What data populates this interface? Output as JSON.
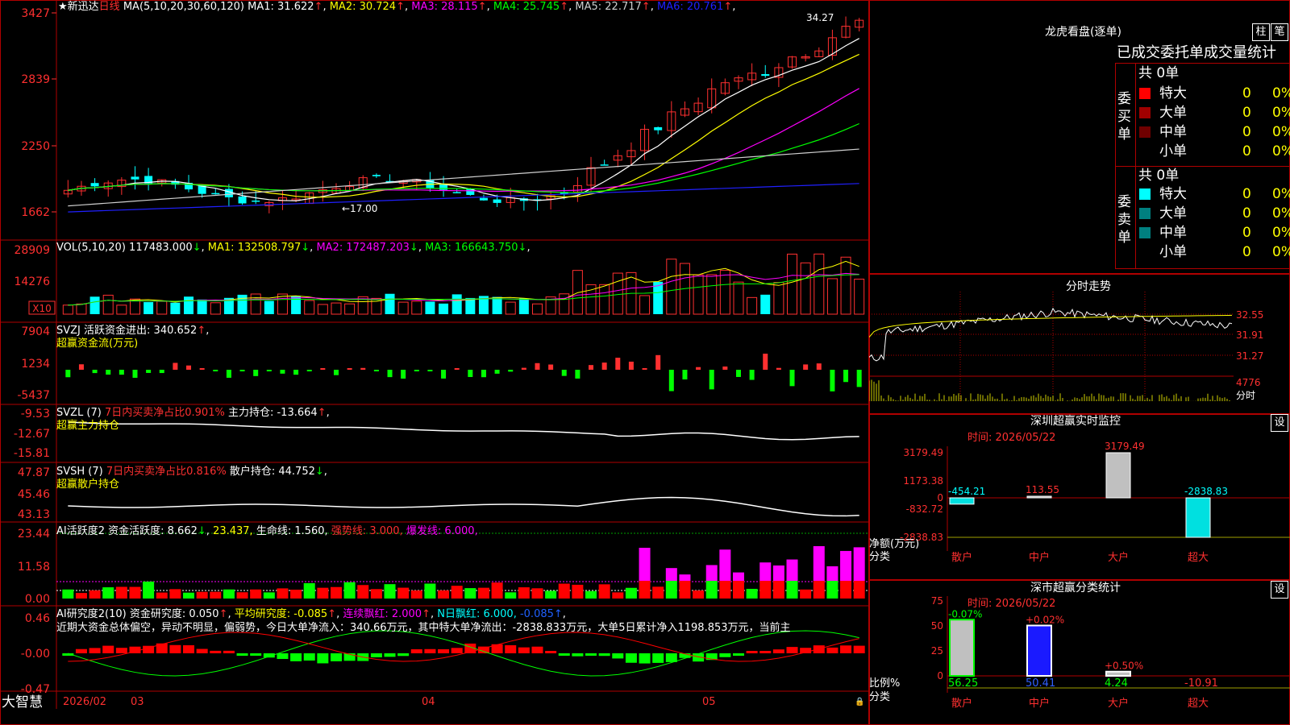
{
  "stock": {
    "star": "★",
    "name": "新迅达",
    "period": "日线"
  },
  "main": {
    "ma_label": "MA(5,10,20,30,60,120)",
    "ma": [
      {
        "name": "MA1",
        "value": "31.622",
        "color": "#ffffff"
      },
      {
        "name": "MA2",
        "value": "30.724",
        "color": "#ffff00"
      },
      {
        "name": "MA3",
        "value": "28.115",
        "color": "#ff00ff"
      },
      {
        "name": "MA4",
        "value": "25.745",
        "color": "#00ff00"
      },
      {
        "name": "MA5",
        "value": "22.717",
        "color": "#d0d0d0"
      },
      {
        "name": "MA6",
        "value": "20.761",
        "color": "#2020ff"
      }
    ],
    "y_ticks": [
      "3427",
      "2839",
      "2250",
      "1662"
    ],
    "high_label": "34.27",
    "low_label": "←17.00"
  },
  "vol": {
    "label": "VOL(5,10,20)",
    "value": "117483.000",
    "ma": [
      {
        "name": "MA1",
        "value": "132508.797",
        "color": "#ffff00"
      },
      {
        "name": "MA2",
        "value": "172487.203",
        "color": "#ff00ff"
      },
      {
        "name": "MA3",
        "value": "166643.750",
        "color": "#00ff00"
      }
    ],
    "y_ticks": [
      "28909",
      "14276"
    ],
    "unit": "X10"
  },
  "svzj": {
    "label": "SVZJ",
    "text": "活跃资金进出: 340.652",
    "sub": "超赢资金流(万元)",
    "y_ticks": [
      "7904",
      "1234",
      "-5437"
    ]
  },
  "svzl": {
    "label": "SVZL (7)",
    "text1": "7日内买卖净占比0.901%",
    "text2": "主力持仓: -13.664",
    "sub": "超赢主力持仓",
    "y_ticks": [
      "-9.53",
      "-12.67",
      "-15.81"
    ]
  },
  "svsh": {
    "label": "SVSH (7)",
    "text1": "7日内买卖净占比0.816%",
    "text2": "散户持仓: 44.752",
    "sub": "超赢散户持仓",
    "y_ticks": [
      "47.87",
      "45.46",
      "43.13"
    ]
  },
  "ai1": {
    "label": "AI活跃度2",
    "t1": "资金活跃度: 8.662",
    "t2": "23.437,",
    "t3": "生命线: 1.560,",
    "t4": "强势线: 3.000,",
    "t5": "爆发线: 6.000,",
    "y_ticks": [
      "23.44",
      "11.58",
      "0.00"
    ]
  },
  "ai2": {
    "label": "AI研究度2(10)",
    "t1": "资金研究度: 0.050",
    "t2": "平均研究度: -0.085",
    "t3": "连续飘红: 2.000",
    "t4": "N日飘红: 6.000,",
    "t5": "-0.085",
    "comment": "近期大资金总体偏空，异动不明显，偏弱势，今日大单净流入：340.66万元，其中特大单净流出：-2838.833万元，大单5日累计净入1198.853万元，当前主",
    "y_ticks": [
      "0.46",
      "-0.00",
      "-0.47"
    ]
  },
  "bottom": {
    "brand": "大智慧",
    "dates": [
      "2026/02",
      "03",
      "04",
      "05"
    ]
  },
  "lhb": {
    "title": "龙虎看盘(逐单)",
    "btn_zhu": "柱",
    "btn_bi": "笔",
    "subtitle": "已成交委托单成交量统计",
    "buy_label": "委买单",
    "sell_label": "委卖单",
    "buy_total": "共 0单",
    "sell_total": "共 0单",
    "buy_rows": [
      {
        "name": "特大",
        "count": "0",
        "pct": "0%",
        "color": "#ff0000"
      },
      {
        "name": "大单",
        "count": "0",
        "pct": "0%",
        "color": "#a00000"
      },
      {
        "name": "中单",
        "count": "0",
        "pct": "0%",
        "color": "#700000"
      },
      {
        "name": "小单",
        "count": "0",
        "pct": "0%",
        "color": ""
      }
    ],
    "sell_rows": [
      {
        "name": "特大",
        "count": "0",
        "pct": "0%",
        "color": "#00ffff"
      },
      {
        "name": "大单",
        "count": "0",
        "pct": "0%",
        "color": "#008080"
      },
      {
        "name": "中单",
        "count": "0",
        "pct": "0%",
        "color": "#008080"
      },
      {
        "name": "小单",
        "count": "0",
        "pct": "0%",
        "color": ""
      }
    ]
  },
  "intraday": {
    "title": "分时走势",
    "y_ticks": [
      "32.55",
      "31.91",
      "31.27"
    ],
    "vol_tick": "4776",
    "vol_label": "分时"
  },
  "monitor": {
    "title": "深圳超赢实时监控",
    "btn": "设",
    "time": "时间: 2026/05/22",
    "y_ticks": [
      "3179.49",
      "1173.38",
      "0",
      "-832.72",
      "-2838.83"
    ],
    "ylabel": "净额(万元)",
    "xlabel": "分类",
    "categories": [
      "散户",
      "中户",
      "大户",
      "超大"
    ],
    "value_labels": [
      "-454.21",
      "113.55",
      "3179.49",
      "-2838.83"
    ]
  },
  "classify": {
    "title": "深市超赢分类统计",
    "btn": "设",
    "time": "时间: 2026/05/22",
    "y_ticks": [
      "75",
      "50",
      "25",
      "0"
    ],
    "ylabel": "比例%",
    "xlabel": "分类",
    "categories": [
      "散户",
      "中户",
      "大户",
      "超大"
    ],
    "top_labels": [
      "-0.07%",
      "+0.02%",
      "+0.50%",
      ""
    ],
    "bottom_labels": [
      "56.25",
      "50.41",
      "4.24",
      "-10.91"
    ]
  },
  "chart_data": [
    {
      "type": "bar",
      "title": "深圳超赢实时监控",
      "xlabel": "分类",
      "ylabel": "净额(万元)",
      "categories": [
        "散户",
        "中户",
        "大户",
        "超大"
      ],
      "values": [
        -454.21,
        113.55,
        3179.49,
        -2838.83
      ],
      "ylim": [
        -2838.83,
        3179.49
      ]
    },
    {
      "type": "bar",
      "title": "深市超赢分类统计",
      "xlabel": "分类",
      "ylabel": "比例%",
      "categories": [
        "散户",
        "中户",
        "大户",
        "超大"
      ],
      "values": [
        56.25,
        50.41,
        4.24,
        -10.91
      ],
      "ylim": [
        0,
        75
      ]
    }
  ]
}
